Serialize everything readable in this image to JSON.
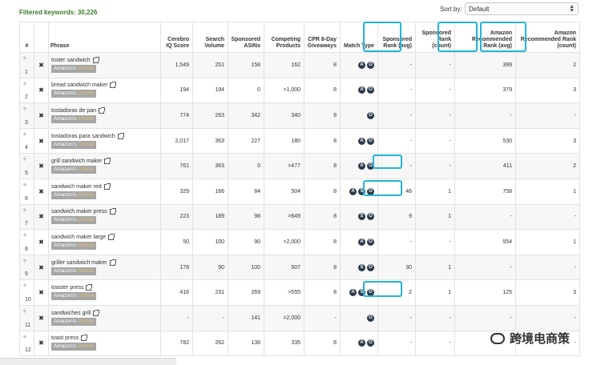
{
  "filter": {
    "label": "Filtered keywords: 30,226"
  },
  "sort": {
    "label": "Sort by:",
    "value": "Default",
    "caret_up": "▲",
    "caret_down": "▼"
  },
  "headers": {
    "idx": "#",
    "phrase": "Phrase",
    "iq": "Cerebro IQ Score",
    "search": "Search Volume",
    "sponsored_asins": "Sponsored ASINs",
    "competing": "Competing Products",
    "cpr": "CPR 8-Day Giveaways",
    "match": "Match Type",
    "spons_rank_avg": "Sponsored Rank (avg)",
    "spons_rank_count": "Sponsored Rank (count)",
    "amz_rec_avg": "Amazon Recommended Rank (avg)",
    "amz_rec_count": "Amazon Recommended Rank (count)"
  },
  "icons": {
    "plus": "+",
    "remove": "✖",
    "match_a": "A",
    "match_s": "S",
    "match_o": "O"
  },
  "badge": {
    "prefix": "Amazon's",
    "suffix": "Choice"
  },
  "rows": [
    {
      "num": "1",
      "phrase": "toster sandwich",
      "iq": "1,549",
      "search": "251",
      "asins": "158",
      "competing": "162",
      "cpr": "8",
      "match": [
        "A",
        "O"
      ],
      "sr_avg": "-",
      "sr_count": "-",
      "ar_avg": "399",
      "ar_count": "2"
    },
    {
      "num": "2",
      "phrase": "bread sandwich maker",
      "iq": "194",
      "search": "194",
      "asins": "0",
      "competing": ">1,000",
      "cpr": "8",
      "match": [
        "A",
        "O"
      ],
      "sr_avg": "-",
      "sr_count": "-",
      "ar_avg": "379",
      "ar_count": "3"
    },
    {
      "num": "3",
      "phrase": "tostadoras de pan",
      "iq": "774",
      "search": "263",
      "asins": "342",
      "competing": "340",
      "cpr": "8",
      "match": [
        "O"
      ],
      "sr_avg": "-",
      "sr_count": "-",
      "ar_avg": "-",
      "ar_count": "-"
    },
    {
      "num": "4",
      "phrase": "tostadoras para sandwich",
      "iq": "2,017",
      "search": "363",
      "asins": "227",
      "competing": "180",
      "cpr": "8",
      "match": [
        "A",
        "O"
      ],
      "sr_avg": "-",
      "sr_count": "-",
      "ar_avg": "530",
      "ar_count": "3"
    },
    {
      "num": "5",
      "phrase": "grill sandwich maker",
      "iq": "761",
      "search": "363",
      "asins": "0",
      "competing": ">477",
      "cpr": "8",
      "match": [
        "A",
        "O"
      ],
      "sr_avg": "-",
      "sr_count": "-",
      "ar_avg": "411",
      "ar_count": "2"
    },
    {
      "num": "6",
      "phrase": "sandwich maker red",
      "iq": "329",
      "search": "166",
      "asins": "84",
      "competing": "504",
      "cpr": "8",
      "match": [
        "A",
        "S",
        "O"
      ],
      "sr_avg": "46",
      "sr_count": "1",
      "ar_avg": "758",
      "ar_count": "1"
    },
    {
      "num": "7",
      "phrase": "sandwich maker press",
      "iq": "223",
      "search": "189",
      "asins": "98",
      "competing": ">849",
      "cpr": "8",
      "match": [
        "S",
        "O"
      ],
      "sr_avg": "9",
      "sr_count": "1",
      "ar_avg": "-",
      "ar_count": "-"
    },
    {
      "num": "8",
      "phrase": "sandwich maker large",
      "iq": "50",
      "search": "100",
      "asins": "90",
      "competing": ">2,000",
      "cpr": "8",
      "match": [
        "A",
        "O"
      ],
      "sr_avg": "-",
      "sr_count": "-",
      "ar_avg": "554",
      "ar_count": "1"
    },
    {
      "num": "9",
      "phrase": "griller sandwich maker",
      "iq": "178",
      "search": "90",
      "asins": "100",
      "competing": "507",
      "cpr": "8",
      "match": [
        "S",
        "O"
      ],
      "sr_avg": "30",
      "sr_count": "1",
      "ar_avg": "-",
      "ar_count": "-"
    },
    {
      "num": "10",
      "phrase": "toaster press",
      "iq": "416",
      "search": "231",
      "asins": "269",
      "competing": ">555",
      "cpr": "8",
      "match": [
        "A",
        "S",
        "O"
      ],
      "sr_avg": "2",
      "sr_count": "1",
      "ar_avg": "125",
      "ar_count": "3"
    },
    {
      "num": "11",
      "phrase": "sandwiches grill",
      "iq": "-",
      "search": "-",
      "asins": "141",
      "competing": ">2,000",
      "cpr": "-",
      "match": [
        "O"
      ],
      "sr_avg": "-",
      "sr_count": "-",
      "ar_avg": "-",
      "ar_count": "-"
    },
    {
      "num": "12",
      "phrase": "toast press",
      "iq": "782",
      "search": "262",
      "asins": "138",
      "competing": "335",
      "cpr": "8",
      "match": [
        "A",
        "O"
      ],
      "sr_avg": "-",
      "sr_count": "-",
      "ar_avg": "-",
      "ar_count": "-"
    }
  ],
  "watermark": {
    "text": "跨境电商策"
  },
  "colors": {
    "highlight": "#24b4d6",
    "green": "#3a8a2a",
    "badge": "#a6a6a6",
    "match_icon": "#2b3a4a"
  }
}
